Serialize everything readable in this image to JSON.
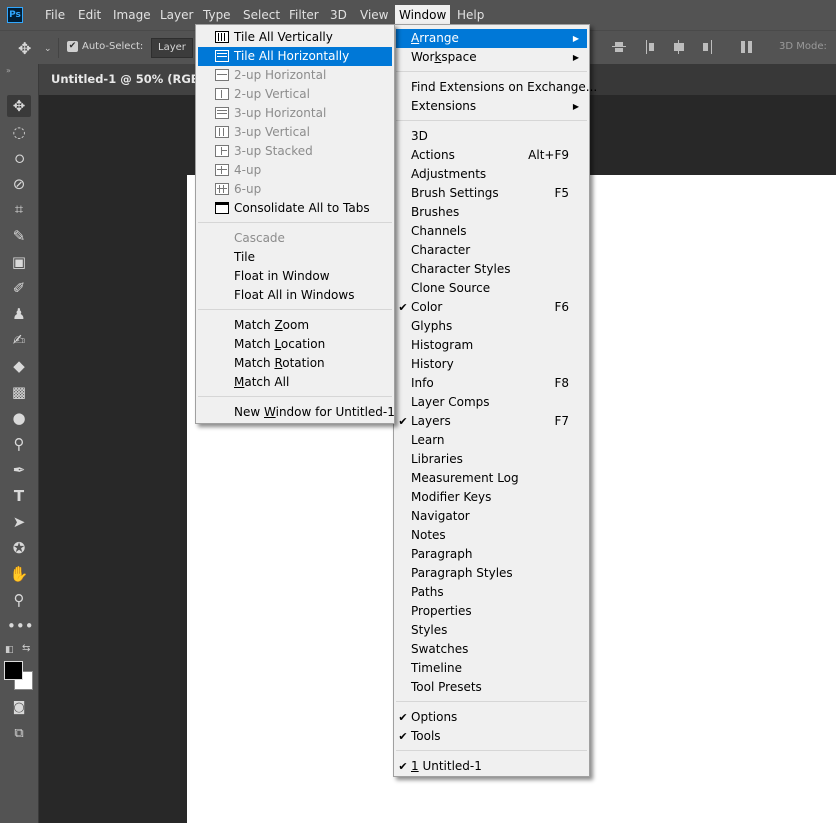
{
  "app": {
    "logo_text": "Ps"
  },
  "menubar": {
    "items": [
      "File",
      "Edit",
      "Image",
      "Layer",
      "Type",
      "Select",
      "Filter",
      "3D",
      "View",
      "Window",
      "Help"
    ]
  },
  "options_bar": {
    "auto_select_label": "Auto-Select:",
    "auto_select_checked": true,
    "layer_select_value": "Layer",
    "mode_3d_label": "3D Mode:"
  },
  "document": {
    "tab_title": "Untitled-1 @ 50% (RGB/8)",
    "canvas_color": "#ffffff"
  },
  "toolbar": {
    "tools": [
      "move",
      "marquee",
      "lasso",
      "quick-selection",
      "crop",
      "eyedropper",
      "spot-healing",
      "brush",
      "clone-stamp",
      "history-brush",
      "eraser",
      "gradient",
      "blur",
      "dodge",
      "pen",
      "type",
      "path-selection",
      "shape",
      "hand",
      "zoom",
      "more"
    ],
    "foreground_color": "#000000",
    "background_color": "#ffffff",
    "type_tool_glyph": "T"
  },
  "window_menu": {
    "sections": [
      [
        {
          "label": "Arrange",
          "underline": "A",
          "submenu": true,
          "highlighted": true
        },
        {
          "label": "Workspace",
          "underline": "k",
          "submenu": true
        }
      ],
      [
        {
          "label": "Find Extensions on Exchange..."
        },
        {
          "label": "Extensions",
          "submenu": true
        }
      ],
      [
        {
          "label": "3D"
        },
        {
          "label": "Actions",
          "shortcut": "Alt+F9"
        },
        {
          "label": "Adjustments"
        },
        {
          "label": "Brush Settings",
          "shortcut": "F5"
        },
        {
          "label": "Brushes"
        },
        {
          "label": "Channels"
        },
        {
          "label": "Character"
        },
        {
          "label": "Character Styles"
        },
        {
          "label": "Clone Source"
        },
        {
          "label": "Color",
          "shortcut": "F6",
          "checked": true
        },
        {
          "label": "Glyphs"
        },
        {
          "label": "Histogram"
        },
        {
          "label": "History"
        },
        {
          "label": "Info",
          "shortcut": "F8"
        },
        {
          "label": "Layer Comps"
        },
        {
          "label": "Layers",
          "shortcut": "F7",
          "checked": true
        },
        {
          "label": "Learn"
        },
        {
          "label": "Libraries"
        },
        {
          "label": "Measurement Log"
        },
        {
          "label": "Modifier Keys"
        },
        {
          "label": "Navigator"
        },
        {
          "label": "Notes"
        },
        {
          "label": "Paragraph"
        },
        {
          "label": "Paragraph Styles"
        },
        {
          "label": "Paths"
        },
        {
          "label": "Properties"
        },
        {
          "label": "Styles"
        },
        {
          "label": "Swatches"
        },
        {
          "label": "Timeline"
        },
        {
          "label": "Tool Presets"
        }
      ],
      [
        {
          "label": "Options",
          "checked": true
        },
        {
          "label": "Tools",
          "checked": true
        }
      ],
      [
        {
          "label": "1 Untitled-1",
          "underline": "1",
          "checked": true
        }
      ]
    ]
  },
  "arrange_submenu": {
    "sections": [
      [
        {
          "label": "Tile All Vertically",
          "icon": "tile-vertical"
        },
        {
          "label": "Tile All Horizontally",
          "icon": "tile-horizontal",
          "highlighted": true
        },
        {
          "label": "2-up Horizontal",
          "icon": "2up-horizontal",
          "disabled": true
        },
        {
          "label": "2-up Vertical",
          "icon": "2up-vertical",
          "disabled": true
        },
        {
          "label": "3-up Horizontal",
          "icon": "3up-horizontal",
          "disabled": true
        },
        {
          "label": "3-up Vertical",
          "icon": "3up-vertical",
          "disabled": true
        },
        {
          "label": "3-up Stacked",
          "icon": "3up-stacked",
          "disabled": true
        },
        {
          "label": "4-up",
          "icon": "4up",
          "disabled": true
        },
        {
          "label": "6-up",
          "icon": "6up",
          "disabled": true
        },
        {
          "label": "Consolidate All to Tabs",
          "icon": "consolidate"
        }
      ],
      [
        {
          "label": "Cascade",
          "disabled": true
        },
        {
          "label": "Tile"
        },
        {
          "label": "Float in Window"
        },
        {
          "label": "Float All in Windows"
        }
      ],
      [
        {
          "label": "Match Zoom",
          "underline": "Z"
        },
        {
          "label": "Match Location",
          "underline": "L"
        },
        {
          "label": "Match Rotation",
          "underline": "R"
        },
        {
          "label": "Match All",
          "underline": "M"
        }
      ],
      [
        {
          "label": "New Window for Untitled-1",
          "underline": "W"
        }
      ]
    ]
  }
}
